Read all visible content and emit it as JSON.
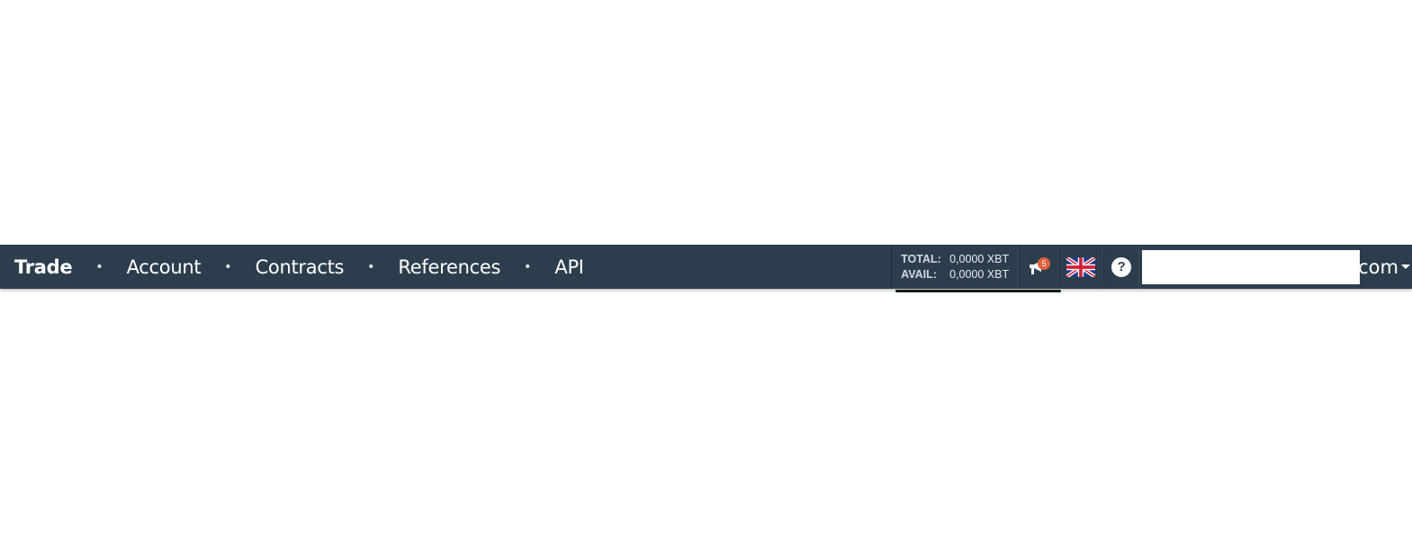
{
  "nav": {
    "items": [
      {
        "label": "Trade",
        "active": true
      },
      {
        "label": "Account",
        "active": false
      },
      {
        "label": "Contracts",
        "active": false
      },
      {
        "label": "References",
        "active": false
      },
      {
        "label": "API",
        "active": false
      }
    ],
    "separator": "•"
  },
  "balance": {
    "total_label": "TOTAL:",
    "total_value": "0,0000 XBT",
    "avail_label": "AVAIL:",
    "avail_value": "0,0000 XBT"
  },
  "notifications": {
    "icon": "megaphone-icon",
    "count": "5",
    "badge_color": "#e0603e"
  },
  "language": {
    "icon": "uk-flag-icon"
  },
  "help": {
    "icon": "help-icon",
    "glyph": "?"
  },
  "user": {
    "email_suffix": "com"
  },
  "colors": {
    "navbar_bg": "#2c3e4e"
  }
}
